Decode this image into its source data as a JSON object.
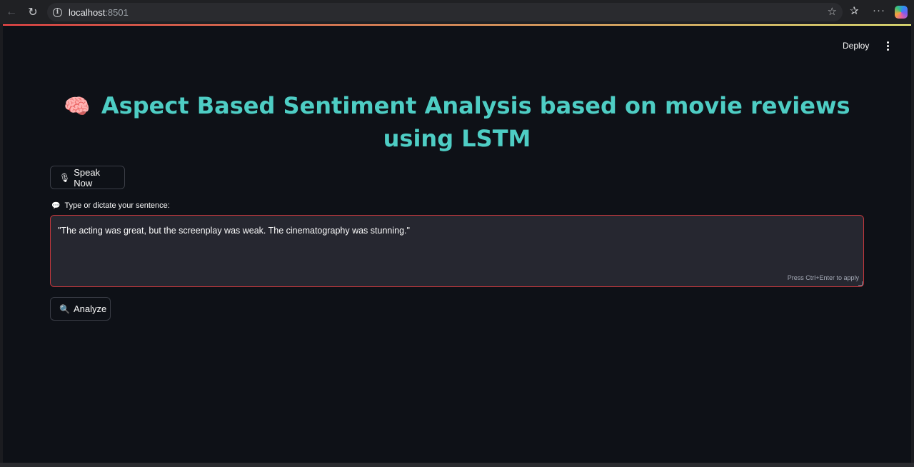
{
  "browser": {
    "url_host": "localhost",
    "url_port": ":8501"
  },
  "app": {
    "deploy_label": "Deploy",
    "title": "Aspect Based Sentiment Analysis based on movie reviews using LSTM",
    "title_icon": "🧠",
    "speak_button": {
      "icon": "🎙",
      "label": "Speak Now"
    },
    "input_label": {
      "icon": "💬",
      "text": "Type or dictate your sentence:"
    },
    "input_value": "\"The acting was great, but the screenplay was weak. The cinematography was stunning.\"",
    "input_hint": "Press Ctrl+Enter to apply",
    "analyze_button": {
      "icon": "🔍",
      "label": "Analyze"
    }
  },
  "colors": {
    "background": "#0e1117",
    "title": "#4ecdc4",
    "input_border": "#c5383d",
    "input_background": "#262730"
  }
}
